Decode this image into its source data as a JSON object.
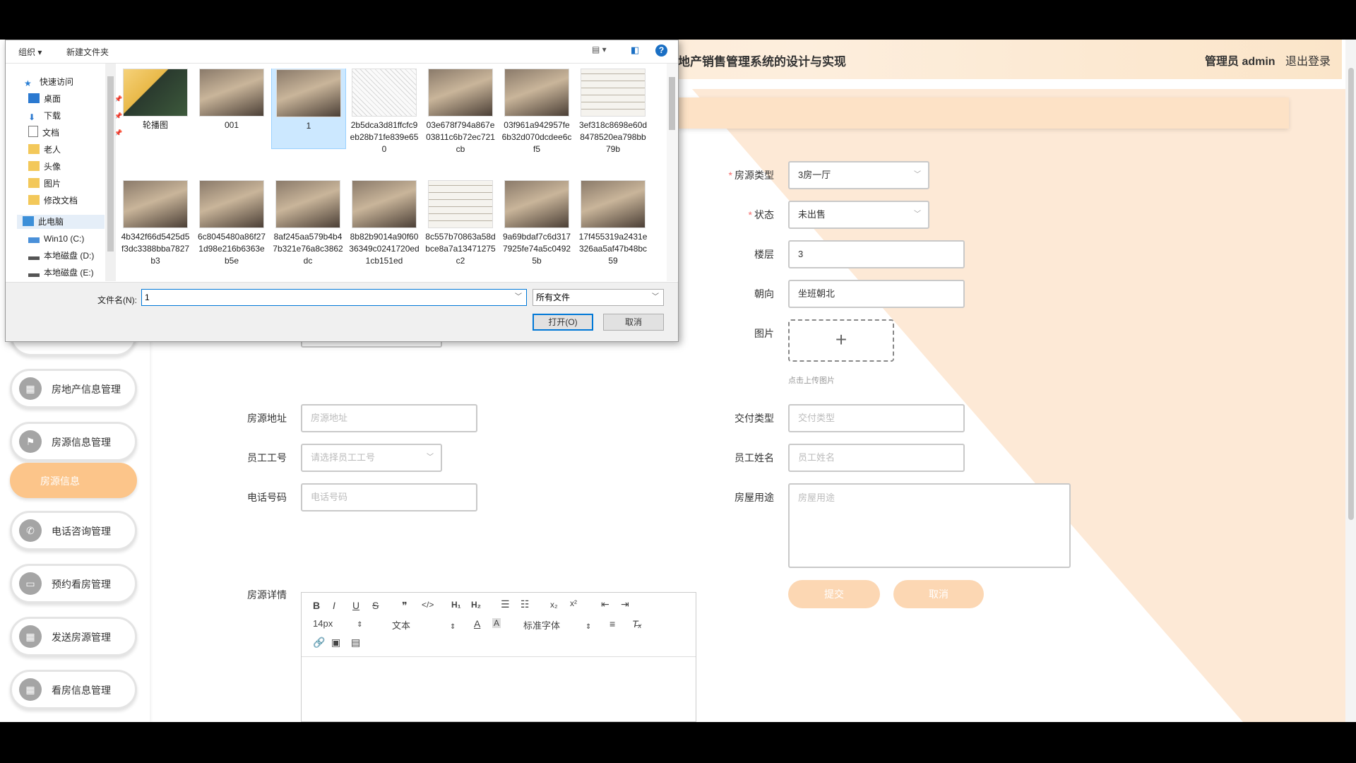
{
  "header": {
    "title": "地产销售管理系统的设计与实现",
    "admin_label": "管理员 admin",
    "logout": "退出登录"
  },
  "sidebar": {
    "items": [
      {
        "label": "房地产信息管理",
        "icon": "grid-icon"
      },
      {
        "label": "房源信息管理",
        "icon": "flag-icon"
      },
      {
        "label": "房源信息",
        "active": true
      },
      {
        "label": "电话咨询管理",
        "icon": "phone-icon"
      },
      {
        "label": "预约看房管理",
        "icon": "monitor-icon"
      },
      {
        "label": "发送房源管理",
        "icon": "grid-icon"
      },
      {
        "label": "看房信息管理",
        "icon": "grid-icon"
      }
    ]
  },
  "form": {
    "house_type": {
      "label": "房源类型",
      "value": "3房一厅"
    },
    "status": {
      "label": "状态",
      "value": "未出售"
    },
    "floor": {
      "label": "楼层",
      "value": "3"
    },
    "orientation": {
      "label": "朝向",
      "value": "坐班朝北"
    },
    "image": {
      "label": "图片",
      "tip": "点击上传图片"
    },
    "address": {
      "label": "房源地址",
      "placeholder": "房源地址"
    },
    "delivery": {
      "label": "交付类型",
      "placeholder": "交付类型"
    },
    "employee_no": {
      "label": "员工工号",
      "placeholder": "请选择员工工号"
    },
    "employee_name": {
      "label": "员工姓名",
      "placeholder": "员工姓名"
    },
    "phone": {
      "label": "电话号码",
      "placeholder": "电话号码"
    },
    "usage": {
      "label": "房屋用途",
      "placeholder": "房屋用途"
    },
    "detail": {
      "label": "房源详情"
    },
    "submit": "提交",
    "cancel": "取消"
  },
  "editor": {
    "font_size": "14px",
    "text_style": "文本",
    "font_family": "标准字体"
  },
  "dialog": {
    "toolbar": {
      "organize": "组织 ▾",
      "new_folder": "新建文件夹"
    },
    "nav": {
      "quick_access": "快速访问",
      "items": [
        "桌面",
        "下载",
        "文档",
        "老人",
        "头像",
        "图片",
        "修改文档"
      ],
      "this_pc": "此电脑",
      "drives": [
        "Win10 (C:)",
        "本地磁盘 (D:)",
        "本地磁盘 (E:)"
      ]
    },
    "files": [
      {
        "name": "轮播图",
        "kind": "folder"
      },
      {
        "name": "001",
        "kind": "image"
      },
      {
        "name": "1",
        "kind": "image",
        "selected": true
      },
      {
        "name": "2b5dca3d81ffcfc9eb28b71fe839e650",
        "kind": "sketch"
      },
      {
        "name": "03e678f794a867e03811c6b72ec721cb",
        "kind": "image"
      },
      {
        "name": "03f961a942957fe6b32d070dcdee6cf5",
        "kind": "image"
      },
      {
        "name": "3ef318c8698e60d8478520ea798bb79b",
        "kind": "plan"
      },
      {
        "name": "4b342f66d5425d5f3dc3388bba7827b3",
        "kind": "image"
      },
      {
        "name": "6c8045480a86f271d98e216b6363eb5e",
        "kind": "image"
      },
      {
        "name": "8af245aa579b4b47b321e76a8c3862dc",
        "kind": "image"
      },
      {
        "name": "8b82b9014a90f6036349c0241720ed1cb151ed",
        "kind": "image"
      },
      {
        "name": "8c557b70863a58dbce8a7a13471275c2",
        "kind": "plan"
      },
      {
        "name": "9a69bdaf7c6d3177925fe74a5c04925b",
        "kind": "image"
      },
      {
        "name": "17f455319a2431e326aa5af47b48bc59",
        "kind": "image"
      }
    ],
    "filename_label": "文件名(N):",
    "filename_value": "1",
    "filetype": "所有文件",
    "open": "打开(O)",
    "cancel": "取消"
  },
  "colors": {
    "accent": "#fcc58a",
    "header_bg": "#fde6cc",
    "diagonal": "#fde9d6"
  }
}
